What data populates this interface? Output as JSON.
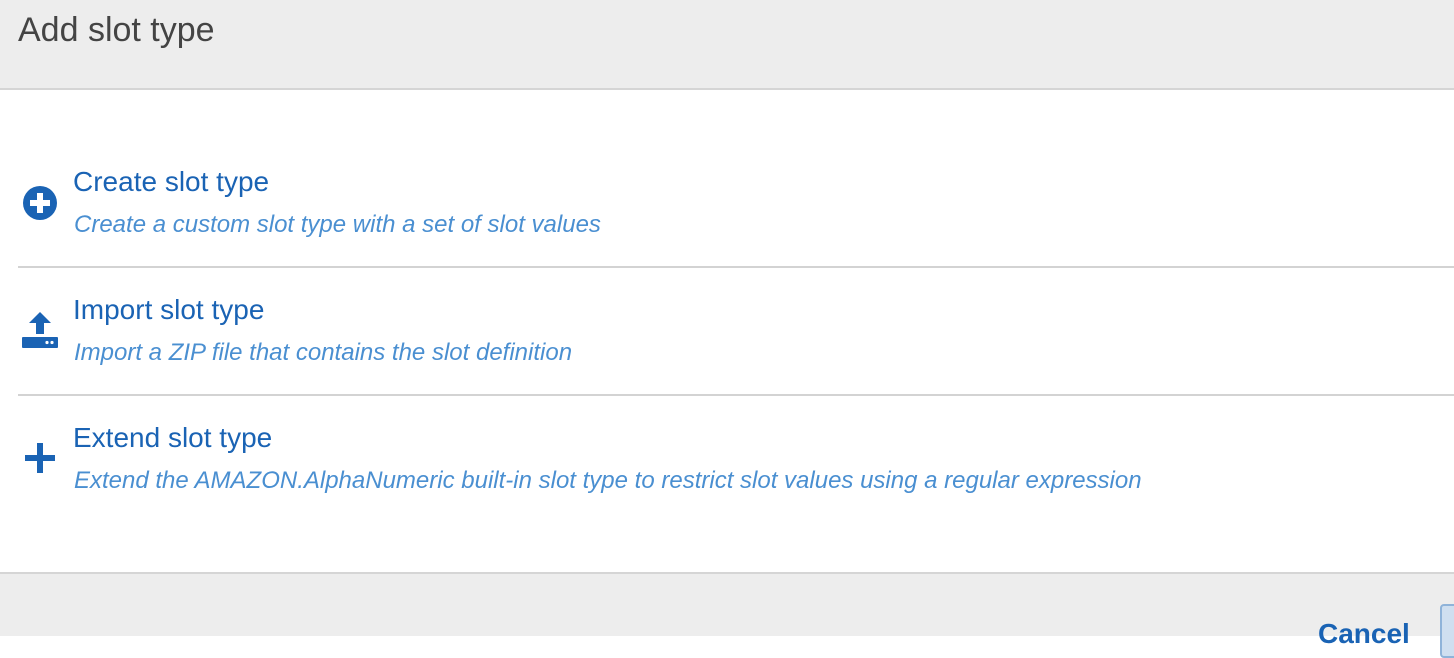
{
  "dialog": {
    "title": "Add slot type"
  },
  "options": [
    {
      "title": "Create slot type",
      "description": "Create a custom slot type with a set of slot values",
      "icon": "plus-circle-icon"
    },
    {
      "title": "Import slot type",
      "description": "Import a ZIP file that contains the slot definition",
      "icon": "upload-icon"
    },
    {
      "title": "Extend slot type",
      "description": "Extend the AMAZON.AlphaNumeric built-in slot type to restrict slot values using a regular expression",
      "icon": "plus-icon"
    }
  ],
  "footer": {
    "cancel_label": "Cancel"
  },
  "colors": {
    "link": "#1a63b4",
    "description": "#4a8fd1",
    "header_bg": "#ededed",
    "divider": "#d3d3d3"
  }
}
